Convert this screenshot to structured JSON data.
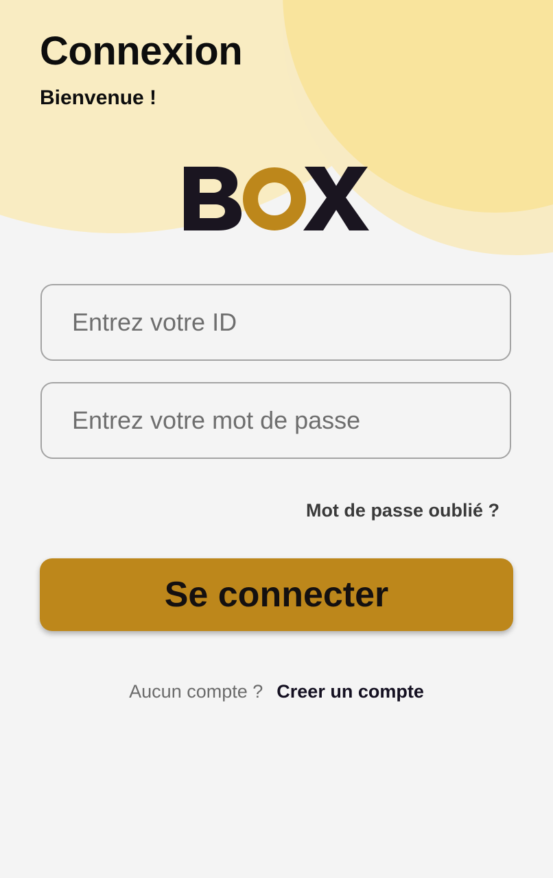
{
  "header": {
    "title": "Connexion",
    "subtitle": "Bienvenue !"
  },
  "logo": {
    "letters": [
      "B",
      "O",
      "X"
    ],
    "dark_color": "#1a1520",
    "accent_color": "#bd871b"
  },
  "form": {
    "id_field": {
      "placeholder": "Entrez votre ID",
      "value": ""
    },
    "password_field": {
      "placeholder": "Entrez votre mot de passe",
      "value": ""
    },
    "forgot_password_label": "Mot de passe oublié ?",
    "login_button_label": "Se connecter"
  },
  "signup": {
    "prompt": "Aucun compte ?",
    "link_label": "Creer un compte"
  },
  "colors": {
    "background": "#f4f4f4",
    "circle_light": "#f9ecc2",
    "circle_dark": "#f9e49d",
    "primary": "#bd871b",
    "text_dark": "#0d0d0d"
  }
}
